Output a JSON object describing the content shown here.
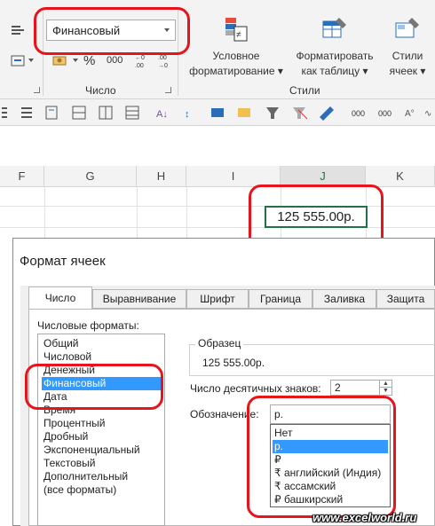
{
  "ribbon": {
    "number_format_value": "Финансовый",
    "percent_symbol": "%",
    "thousands_symbol": "000",
    "group_number_label": "Число",
    "conditional_line1": "Условное",
    "conditional_line2": "форматирование",
    "format_table_line1": "Форматировать",
    "format_table_line2": "как таблицу",
    "cell_styles_line1": "Стили",
    "cell_styles_line2": "ячеек",
    "group_styles_label": "Стили"
  },
  "sheet": {
    "columns": [
      "F",
      "G",
      "H",
      "I",
      "J",
      "K"
    ],
    "active_cell_value": "125 555.00р."
  },
  "dialog": {
    "title": "Формат ячеек",
    "tabs": [
      "Число",
      "Выравнивание",
      "Шрифт",
      "Граница",
      "Заливка",
      "Защита"
    ],
    "formats_label": "Числовые форматы:",
    "formats": [
      "Общий",
      "Числовой",
      "Денежный",
      "Финансовый",
      "Дата",
      "Время",
      "Процентный",
      "Дробный",
      "Экспоненциальный",
      "Текстовый",
      "Дополнительный",
      "(все форматы)"
    ],
    "selected_format": "Финансовый",
    "sample_label": "Образец",
    "sample_value": "125 555.00р.",
    "decimals_label": "Число десятичных знаков:",
    "decimals_value": "2",
    "symbol_label": "Обозначение:",
    "symbol_value": "р.",
    "symbol_options": [
      "Нет",
      "р.",
      "₽",
      "₹ английский (Индия)",
      "₹ ассамский",
      "₽ башкирский"
    ],
    "selected_symbol": "р."
  },
  "watermark": "www.excelworld.ru",
  "colors": {
    "highlight": "#e8141c",
    "selection": "#3399ff",
    "active_column": "#217346"
  }
}
